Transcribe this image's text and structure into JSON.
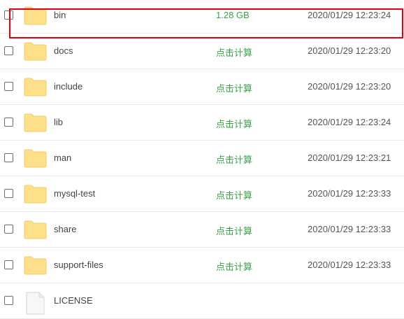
{
  "files": [
    {
      "name": "bin",
      "size": "1.28 GB",
      "modified": "2020/01/29 12:23:24",
      "icon": "folder-icon"
    },
    {
      "name": "docs",
      "size": "点击计算",
      "modified": "2020/01/29 12:23:20",
      "icon": "folder-icon"
    },
    {
      "name": "include",
      "size": "点击计算",
      "modified": "2020/01/29 12:23:20",
      "icon": "folder-icon"
    },
    {
      "name": "lib",
      "size": "点击计算",
      "modified": "2020/01/29 12:23:24",
      "icon": "folder-icon"
    },
    {
      "name": "man",
      "size": "点击计算",
      "modified": "2020/01/29 12:23:21",
      "icon": "folder-icon"
    },
    {
      "name": "mysql-test",
      "size": "点击计算",
      "modified": "2020/01/29 12:23:33",
      "icon": "folder-icon"
    },
    {
      "name": "share",
      "size": "点击计算",
      "modified": "2020/01/29 12:23:33",
      "icon": "folder-icon"
    },
    {
      "name": "support-files",
      "size": "点击计算",
      "modified": "2020/01/29 12:23:33",
      "icon": "folder-icon"
    },
    {
      "name": "LICENSE",
      "size": "",
      "modified": "",
      "icon": "file-icon"
    }
  ],
  "colors": {
    "folder_fill": "#ffe08a",
    "size_link": "#3aa14a",
    "highlight_box": "#e3000f"
  }
}
